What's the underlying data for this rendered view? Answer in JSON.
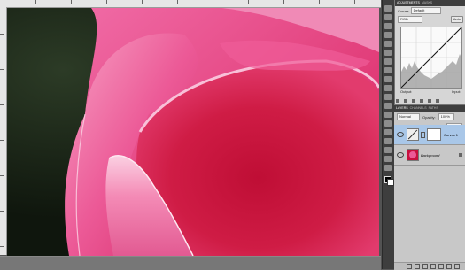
{
  "adjustments_panel": {
    "tabs": [
      "ADJUSTMENTS",
      "MASKS"
    ],
    "label_curves": "Curves",
    "preset_value": "Default",
    "channel_value": "RGB",
    "auto_label": "Auto",
    "output_label": "Output:",
    "input_label": "Input:"
  },
  "layers_panel": {
    "tabs": [
      "LAYERS",
      "CHANNELS",
      "PATHS"
    ],
    "blend_mode": "Normal",
    "opacity_label": "Opacity:",
    "opacity_value": "100%",
    "lock_label": "Lock:",
    "fill_label": "Fill:",
    "fill_value": "100%",
    "layers": [
      {
        "name": "Curves 1"
      },
      {
        "name": "Background"
      }
    ]
  },
  "colors": {
    "ui_dark": "#535353",
    "panel_bg": "#d6d6d6",
    "selected_layer": "#a9c7e8",
    "photo_pink": "#e8488a",
    "photo_deep": "#c8103e"
  },
  "icons": [
    "eye-icon",
    "chain-link-icon",
    "lock-icon",
    "fx-icon",
    "mask-icon",
    "new-layer-icon",
    "trash-icon"
  ]
}
